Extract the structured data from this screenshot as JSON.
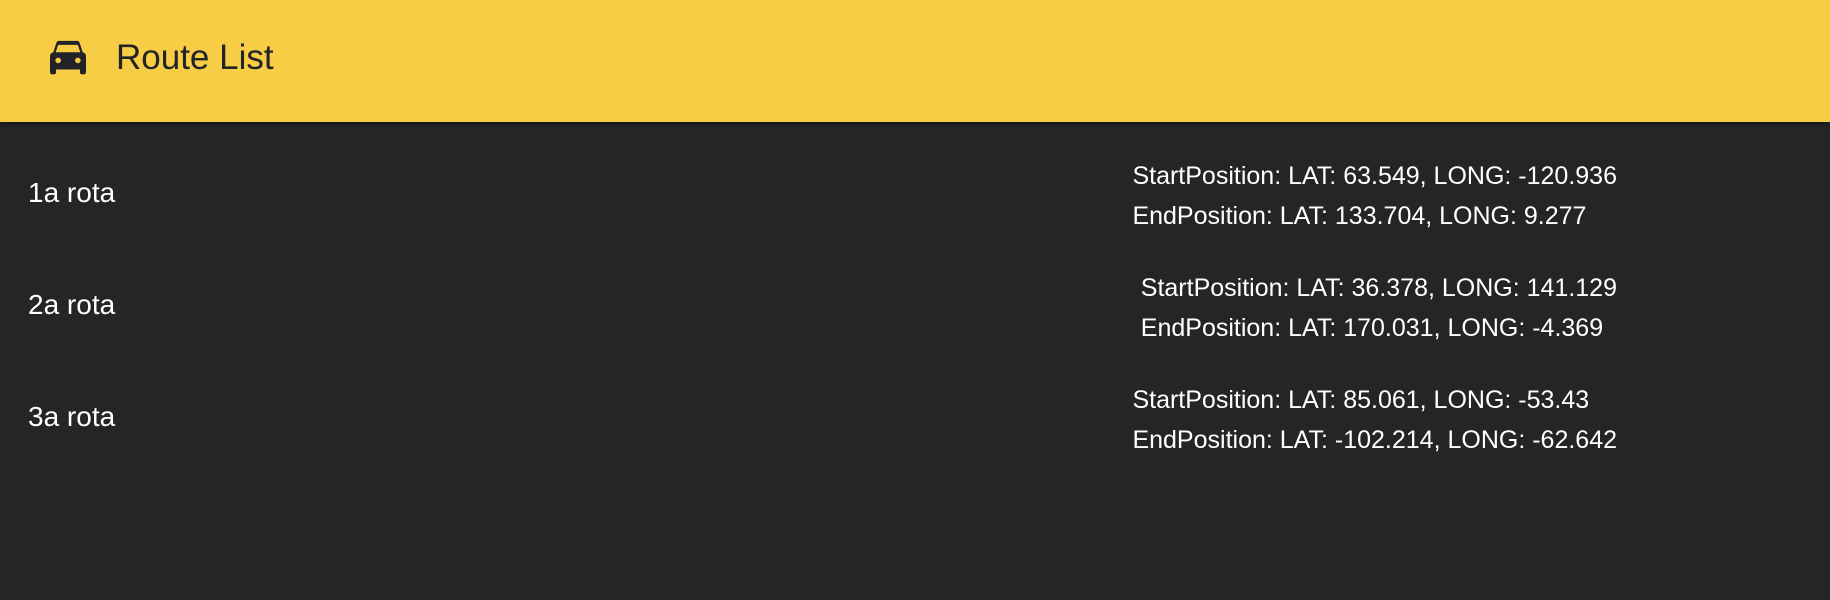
{
  "appbar": {
    "title": "Route List",
    "icon": "car-icon",
    "color": "#F7CD46"
  },
  "routes": [
    {
      "name": "1a rota",
      "start": "StartPosition: LAT: 63.549, LONG: -120.936",
      "end": "EndPosition: LAT: 133.704, LONG: 9.277"
    },
    {
      "name": "2a rota",
      "start": "StartPosition: LAT: 36.378, LONG: 141.129",
      "end": "EndPosition: LAT: 170.031, LONG: -4.369"
    },
    {
      "name": "3a rota",
      "start": "StartPosition: LAT: 85.061, LONG: -53.43",
      "end": "EndPosition: LAT: -102.214, LONG: -62.642"
    }
  ]
}
